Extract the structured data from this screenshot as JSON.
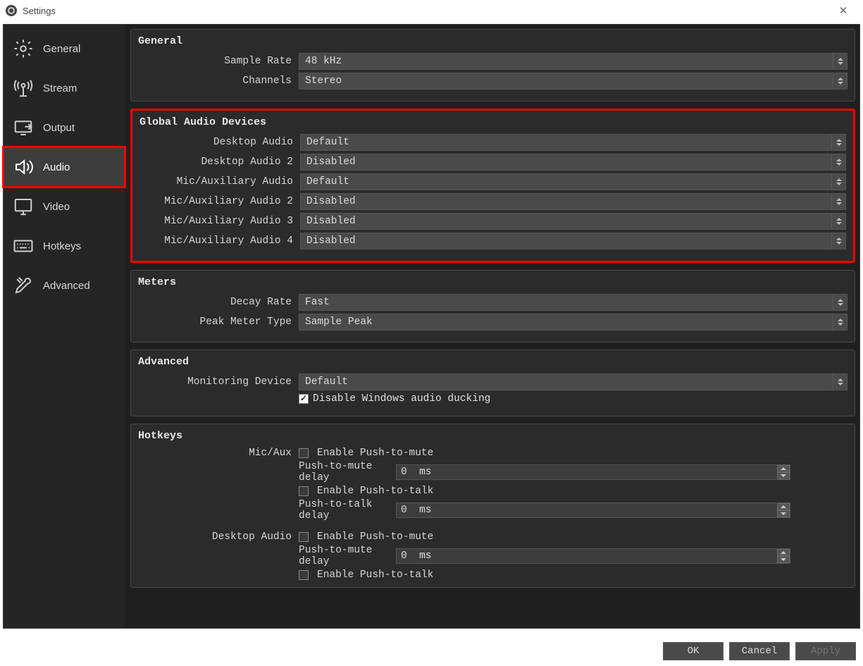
{
  "window": {
    "title": "Settings"
  },
  "sidebar": {
    "items": [
      {
        "label": "General"
      },
      {
        "label": "Stream"
      },
      {
        "label": "Output"
      },
      {
        "label": "Audio"
      },
      {
        "label": "Video"
      },
      {
        "label": "Hotkeys"
      },
      {
        "label": "Advanced"
      }
    ],
    "selected_index": 3
  },
  "sections": {
    "general": {
      "title": "General",
      "sample_rate_label": "Sample Rate",
      "sample_rate_value": "48 kHz",
      "channels_label": "Channels",
      "channels_value": "Stereo"
    },
    "global_audio": {
      "title": "Global Audio Devices",
      "rows": [
        {
          "label": "Desktop Audio",
          "value": "Default"
        },
        {
          "label": "Desktop Audio 2",
          "value": "Disabled"
        },
        {
          "label": "Mic/Auxiliary Audio",
          "value": "Default"
        },
        {
          "label": "Mic/Auxiliary Audio 2",
          "value": "Disabled"
        },
        {
          "label": "Mic/Auxiliary Audio 3",
          "value": "Disabled"
        },
        {
          "label": "Mic/Auxiliary Audio 4",
          "value": "Disabled"
        }
      ]
    },
    "meters": {
      "title": "Meters",
      "decay_label": "Decay Rate",
      "decay_value": "Fast",
      "peak_label": "Peak Meter Type",
      "peak_value": "Sample Peak"
    },
    "advanced": {
      "title": "Advanced",
      "monitoring_label": "Monitoring Device",
      "monitoring_value": "Default",
      "ducking_label": "Disable Windows audio ducking",
      "ducking_checked": true
    },
    "hotkeys": {
      "title": "Hotkeys",
      "groups": [
        {
          "name": "Mic/Aux",
          "enable_ptm": "Enable Push-to-mute",
          "ptm_delay_label": "Push-to-mute delay",
          "ptm_delay_value": "0",
          "ptm_delay_unit": "ms",
          "enable_ptt": "Enable Push-to-talk",
          "ptt_delay_label": "Push-to-talk delay",
          "ptt_delay_value": "0",
          "ptt_delay_unit": "ms"
        },
        {
          "name": "Desktop Audio",
          "enable_ptm": "Enable Push-to-mute",
          "ptm_delay_label": "Push-to-mute delay",
          "ptm_delay_value": "0",
          "ptm_delay_unit": "ms",
          "enable_ptt": "Enable Push-to-talk"
        }
      ]
    }
  },
  "footer": {
    "ok": "OK",
    "cancel": "Cancel",
    "apply": "Apply"
  }
}
